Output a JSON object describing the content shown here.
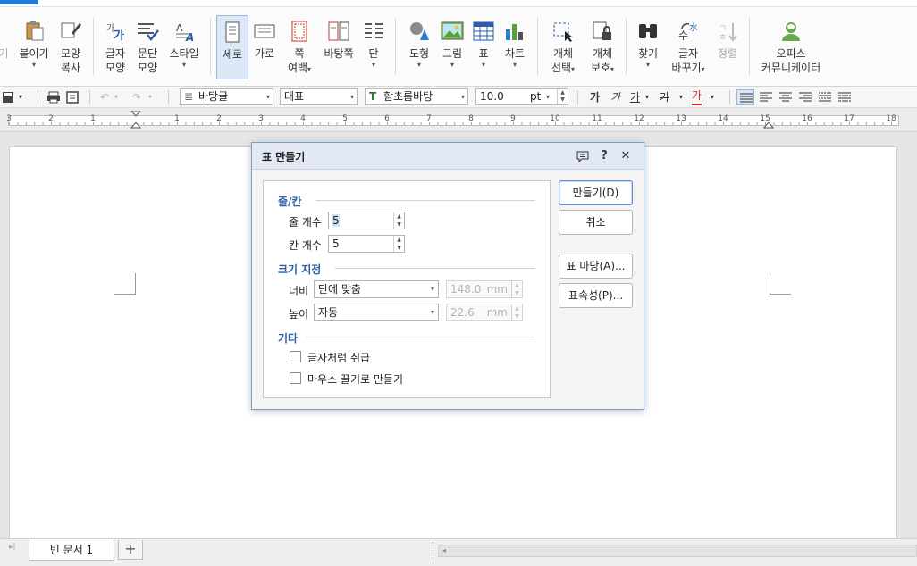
{
  "ribbon": {
    "items": [
      {
        "label1": "기",
        "label2": "",
        "arrow": false,
        "disabled": true
      },
      {
        "label1": "붙이기",
        "label2": "",
        "arrow": true
      },
      {
        "label1": "모양",
        "label2": "복사",
        "arrow": false
      },
      {
        "label1": "글자",
        "label2": "모양",
        "arrow": false
      },
      {
        "label1": "문단",
        "label2": "모양",
        "arrow": false
      },
      {
        "label1": "스타일",
        "label2": "",
        "arrow": true
      },
      {
        "label1": "세로",
        "label2": "",
        "arrow": false,
        "active": true
      },
      {
        "label1": "가로",
        "label2": "",
        "arrow": false
      },
      {
        "label1": "쪽",
        "label2": "여백",
        "arrow": true
      },
      {
        "label1": "바탕쪽",
        "label2": "",
        "arrow": false
      },
      {
        "label1": "단",
        "label2": "",
        "arrow": true
      },
      {
        "label1": "도형",
        "label2": "",
        "arrow": true
      },
      {
        "label1": "그림",
        "label2": "",
        "arrow": true
      },
      {
        "label1": "표",
        "label2": "",
        "arrow": true
      },
      {
        "label1": "차트",
        "label2": "",
        "arrow": true
      },
      {
        "label1": "개체",
        "label2": "선택",
        "arrow": true
      },
      {
        "label1": "개체",
        "label2": "보호",
        "arrow": true
      },
      {
        "label1": "찾기",
        "label2": "",
        "arrow": true
      },
      {
        "label1": "글자",
        "label2": "바꾸기",
        "arrow": true
      },
      {
        "label1": "정렬",
        "label2": "",
        "arrow": false,
        "disabled": true
      },
      {
        "label1": "오피스",
        "label2": "커뮤니케이터",
        "arrow": false
      }
    ]
  },
  "toolbar": {
    "style_combo": "바탕글",
    "lang_combo": "대표",
    "font_combo": "함초롬바탕",
    "size_value": "10.0",
    "size_unit": "pt",
    "font_glyph": "가"
  },
  "ruler": {
    "numbers": [
      "3",
      "2",
      "1",
      "",
      "1",
      "2",
      "3",
      "4",
      "5",
      "6",
      "7",
      "8",
      "9",
      "10",
      "11",
      "12",
      "13",
      "14",
      "15",
      "16",
      "17",
      "18"
    ]
  },
  "tabs": {
    "doc_tab": "빈 문서 1",
    "add": "+"
  },
  "dialog": {
    "title": "표 만들기",
    "sections": {
      "rowcol": "줄/칸",
      "size": "크기 지정",
      "other": "기타"
    },
    "rows_label": "줄 개수",
    "rows_value": "5",
    "cols_label": "칸 개수",
    "cols_value": "5",
    "width_label": "너비",
    "width_option": "단에 맞춤",
    "width_value": "148.0",
    "width_unit": "mm",
    "height_label": "높이",
    "height_option": "자동",
    "height_value": "22.6",
    "height_unit": "mm",
    "check_as_char": "글자처럼 취급",
    "check_mouse_drag": "마우스 끌기로 만들기",
    "buttons": {
      "create": "만들기(D)",
      "cancel": "취소",
      "table_style": "표 마당(A)...",
      "properties": "표속성(P)..."
    }
  }
}
